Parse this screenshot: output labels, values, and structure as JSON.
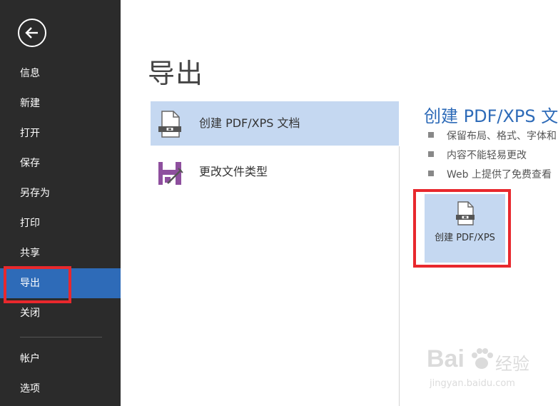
{
  "sidebar": {
    "items": [
      {
        "label": "信息"
      },
      {
        "label": "新建"
      },
      {
        "label": "打开"
      },
      {
        "label": "保存"
      },
      {
        "label": "另存为"
      },
      {
        "label": "打印"
      },
      {
        "label": "共享"
      },
      {
        "label": "导出",
        "selected": true
      },
      {
        "label": "关闭"
      },
      {
        "label": "帐户"
      },
      {
        "label": "选项"
      }
    ]
  },
  "main": {
    "title": "导出",
    "options": [
      {
        "label": "创建 PDF/XPS 文档",
        "icon": "pdf-document-icon",
        "selected": true
      },
      {
        "label": "更改文件类型",
        "icon": "change-file-type-icon",
        "selected": false
      }
    ],
    "detail": {
      "title": "创建 PDF/XPS 文",
      "bullets": [
        "保留布局、格式、字体和",
        "内容不能轻易更改",
        "Web 上提供了免费查看"
      ],
      "button_label": "创建 PDF/XPS"
    }
  },
  "watermark": {
    "brand": "Bai",
    "brand_suffix": "经验",
    "url": "jingyan.baidu.com"
  },
  "colors": {
    "sidebar_bg": "#2b2b2b",
    "accent": "#2e6bb8",
    "selection_bg": "#c5d8f1",
    "highlight_red": "#e8282d"
  }
}
